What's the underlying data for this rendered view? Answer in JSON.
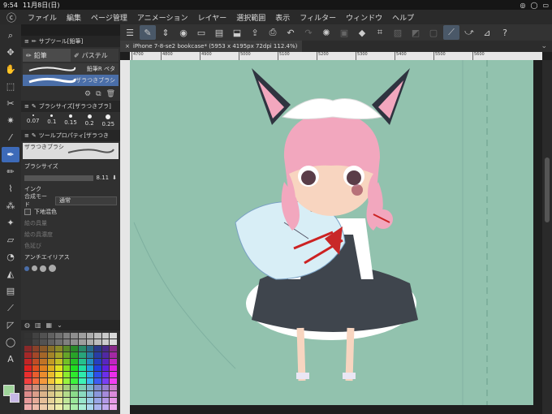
{
  "status": {
    "time": "9:54",
    "date": "11月8日(日)",
    "indicators": [
      "◎",
      "◯",
      "▭"
    ]
  },
  "menu": {
    "items": [
      "ファイル",
      "編集",
      "ページ管理",
      "アニメーション",
      "レイヤー",
      "選択範囲",
      "表示",
      "フィルター",
      "ウィンドウ",
      "ヘルプ"
    ]
  },
  "document_tab": {
    "title": "iPhone 7-8-se2 bookcase* (5953 x 4195px 72dpi 112.4%)"
  },
  "ruler": {
    "ticks": [
      "4700",
      "4800",
      "4900",
      "5000",
      "5100",
      "5200",
      "5300",
      "5400",
      "5500",
      "5600"
    ]
  },
  "subtool": {
    "header": "サブツール[鉛筆]",
    "tabs": [
      {
        "label": "鉛筆"
      },
      {
        "label": "パステル"
      }
    ],
    "brushes": [
      {
        "label": "鉛筆R ペタ"
      },
      {
        "label": "ザラつきブラシ"
      }
    ]
  },
  "brush_size_panel": {
    "header": "ブラシサイズ[ザラつきブラ]",
    "sizes": [
      "0.07",
      "0.1",
      "0.15",
      "0.2",
      "0.25"
    ]
  },
  "tool_property": {
    "header": "ツールプロパティ[ザラつき",
    "preview_label": "ザラつきブラシ",
    "brush_size_label": "ブラシサイズ",
    "brush_size_value": "8.11",
    "ink_label": "インク",
    "blend_label": "合成モード",
    "blend_value": "通常",
    "underlay_label": "下地混色",
    "paint_amount": "絵の具量",
    "paint_density": "絵の具濃度",
    "color_stretch": "色延び",
    "antialias_label": "アンチエイリアス"
  },
  "colors": {
    "accent": "#3d6ab8",
    "canvas_bg": "#92c2ae",
    "main_color": "#9fd49a",
    "sub_color": "#c7b8e6"
  }
}
